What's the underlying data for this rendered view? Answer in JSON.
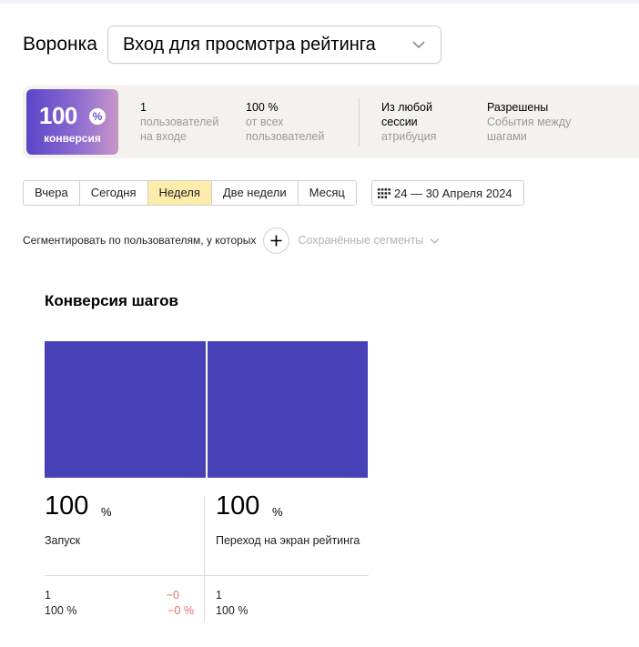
{
  "header": {
    "funnel_label": "Воронка",
    "funnel_selected": "Вход для просмотра рейтинга"
  },
  "summary": {
    "conversion_value": "100",
    "conversion_percent_sign": "%",
    "conversion_label": "конверсия",
    "stats": [
      {
        "value": "1",
        "line1": "пользователей",
        "line2": "на входе"
      },
      {
        "value": "100 %",
        "line1": "от всех",
        "line2": "пользователей"
      },
      {
        "value": "Из любой",
        "line1_dark": "сессии",
        "line2": "атрибуция"
      },
      {
        "value": "Разрешены",
        "line1": "События между",
        "line2": "шагами"
      }
    ]
  },
  "periods": [
    {
      "label": "Вчера",
      "active": false
    },
    {
      "label": "Сегодня",
      "active": false
    },
    {
      "label": "Неделя",
      "active": true
    },
    {
      "label": "Две недели",
      "active": false
    },
    {
      "label": "Месяц",
      "active": false
    }
  ],
  "date_range": "24 — 30 Апреля 2024",
  "segment": {
    "label": "Сегментировать по пользователям, у которых",
    "saved_segments": "Сохранённые сегменты"
  },
  "steps_title": "Конверсия шагов",
  "bar_color": "#4740b7",
  "delta_color": "#ea6b6b",
  "chart_data": {
    "type": "bar",
    "categories": [
      "Запуск",
      "Переход на экран рейтинга"
    ],
    "values": [
      100,
      100
    ],
    "ylim": [
      0,
      100
    ]
  },
  "steps": [
    {
      "pct": "100",
      "pct_sign": "%",
      "name": "Запуск",
      "users": "1",
      "users_pct": "100 %",
      "delta_users": "−0",
      "delta_pct": "−0 %"
    },
    {
      "pct": "100",
      "pct_sign": "%",
      "name": "Переход на экран рейтинга",
      "users": "1",
      "users_pct": "100 %"
    }
  ]
}
